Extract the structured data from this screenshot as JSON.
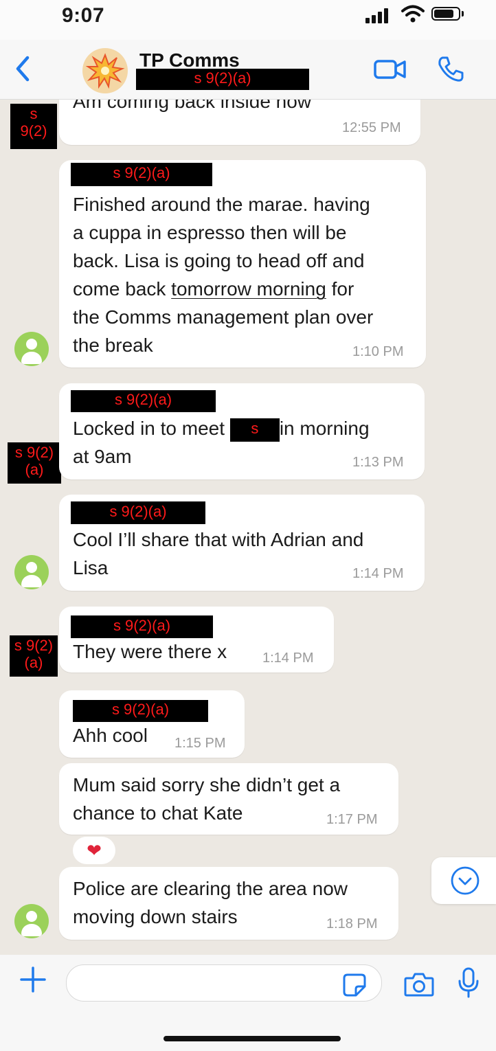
{
  "status_bar": {
    "time": "9:07"
  },
  "header": {
    "title": "TP Comms",
    "subtitle_redaction": "s 9(2)(a)",
    "accent_color": "#1f7aec"
  },
  "messages": [
    {
      "sender_redaction": "s 9(2)",
      "text_lines": [
        "Am coming back inside now"
      ],
      "time": "12:55 PM"
    },
    {
      "sender_redaction": "s 9(2)(a)",
      "text_lines": [
        "Finished around the marae. having",
        "a cuppa in espresso then will be",
        "back. Lisa is going to head off and",
        "come back ",
        "tomorrow morning",
        " for",
        "the Comms management plan over",
        "the break"
      ],
      "time": "1:10 PM"
    },
    {
      "sender_redaction": "s 9(2)(a)",
      "side_redaction": "s 9(2)(a)",
      "text_before": "Locked in to meet ",
      "inline_redaction": "s",
      "text_after": "in morning",
      "text_line2": "at 9am",
      "time": "1:13 PM"
    },
    {
      "sender_redaction": "s 9(2)(a)",
      "text_lines": [
        "Cool I’ll share that with Adrian and",
        "Lisa"
      ],
      "time": "1:14 PM"
    },
    {
      "sender_redaction": "s 9(2)(a)",
      "side_redaction": "s 9(2)(a)",
      "text_lines": [
        "They were there x"
      ],
      "time": "1:14 PM"
    },
    {
      "sender_redaction": "s 9(2)(a)",
      "text_lines": [
        "Ahh cool"
      ],
      "time": "1:15 PM"
    },
    {
      "text_lines": [
        "Mum said sorry she didn’t get a",
        "chance to chat Kate"
      ],
      "time": "1:17 PM",
      "reaction": "❤"
    },
    {
      "text_lines": [
        "Police are clearing the area now",
        "moving down stairs"
      ],
      "time": "1:18 PM"
    }
  ],
  "icons": {
    "back": "chevron-left-icon",
    "video": "video-camera-icon",
    "phone": "phone-icon",
    "plus": "plus-icon",
    "sticker": "sticker-icon",
    "camera": "camera-icon",
    "mic": "microphone-icon",
    "scroll_down": "chevron-down-circle-icon"
  }
}
